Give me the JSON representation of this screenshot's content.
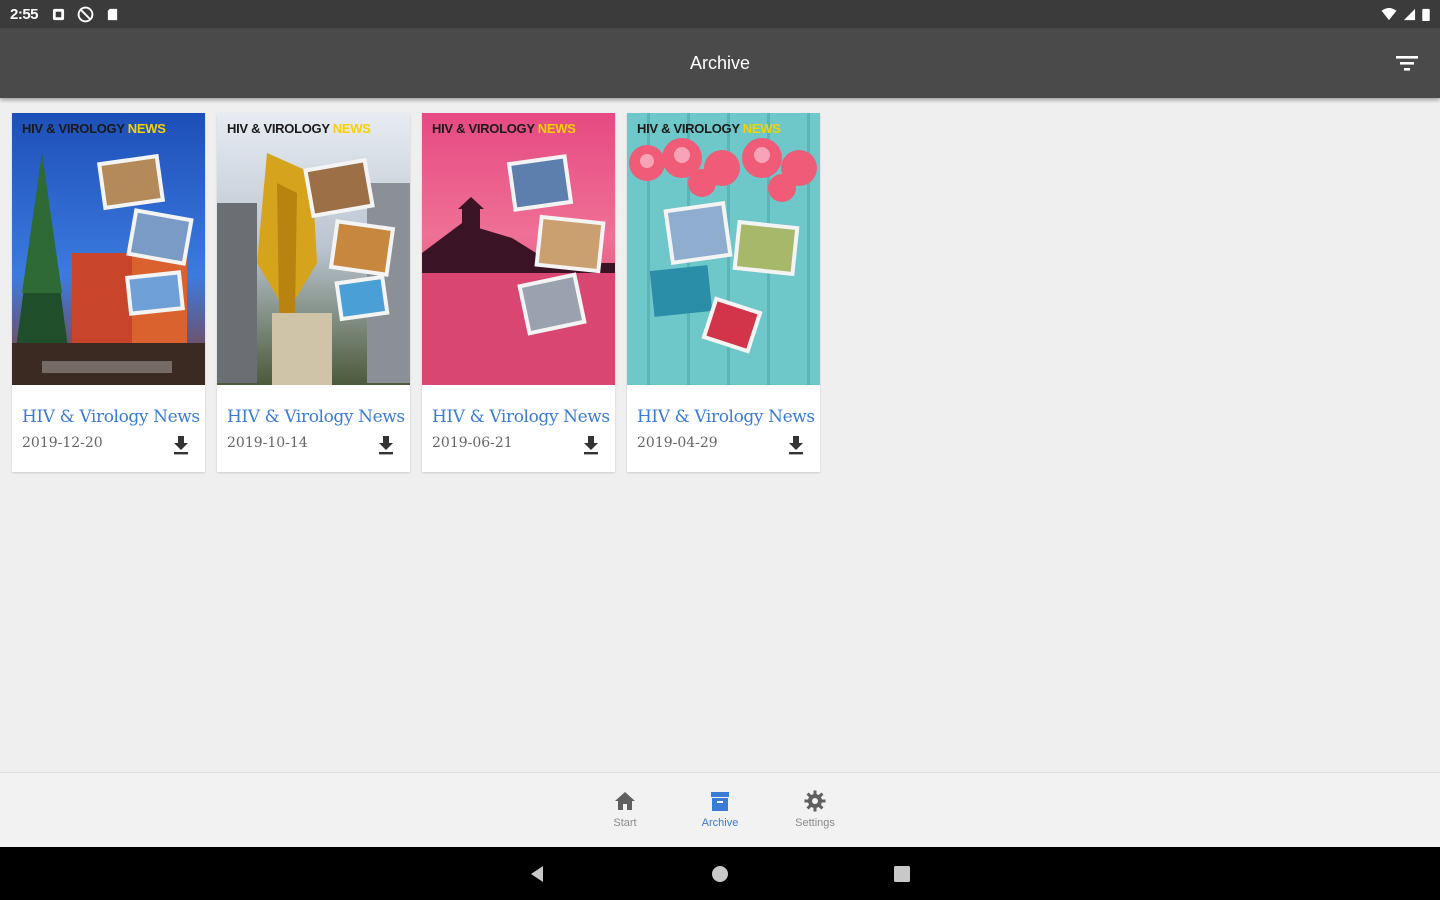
{
  "status_bar": {
    "time": "2:55"
  },
  "app_bar": {
    "title": "Archive"
  },
  "issues": [
    {
      "title": "HIV & Virology News",
      "date": "2019-12-20",
      "masthead_main": "HIV & VIROLOGY",
      "masthead_accent": "NEWS"
    },
    {
      "title": "HIV & Virology News",
      "date": "2019-10-14",
      "masthead_main": "HIV & VIROLOGY",
      "masthead_accent": "NEWS"
    },
    {
      "title": "HIV & Virology News",
      "date": "2019-06-21",
      "masthead_main": "HIV & VIROLOGY",
      "masthead_accent": "NEWS"
    },
    {
      "title": "HIV & Virology News",
      "date": "2019-04-29",
      "masthead_main": "HIV & VIROLOGY",
      "masthead_accent": "NEWS"
    }
  ],
  "bottom_nav": {
    "items": [
      {
        "label": "Start",
        "icon": "home-icon"
      },
      {
        "label": "Archive",
        "icon": "archive-icon",
        "active": true
      },
      {
        "label": "Settings",
        "icon": "gear-icon"
      }
    ]
  },
  "colors": {
    "accent": "#3a7bd5",
    "app_bar": "#4a4a4a",
    "status_bar": "#3b3b3b"
  }
}
